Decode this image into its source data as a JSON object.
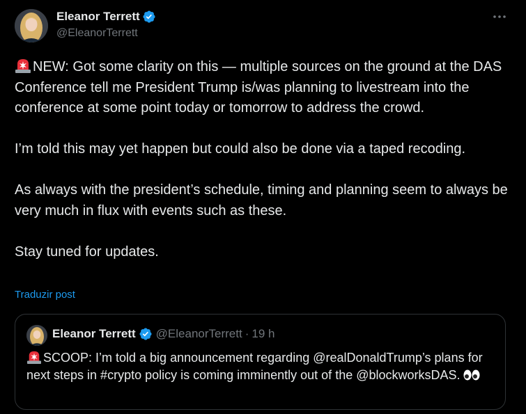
{
  "post": {
    "author": {
      "display_name": "Eleanor Terrett",
      "handle": "@EleanorTerrett",
      "avatar_icon": "profile-photo",
      "verified_icon": "verified-badge-icon"
    },
    "more_icon": "more-horizontal-icon",
    "paragraphs": [
      "NEW: Got some clarity on this — multiple sources on the ground at the DAS Conference tell me President Trump is/was planning to livestream into the conference at some point today or tomorrow to address the crowd.",
      "I’m told this may yet happen but could also be done via a taped recoding.",
      "As always with the president’s schedule, timing and planning seem to always be very much in flux with events such as these.",
      "Stay tuned for updates."
    ],
    "translate_label": "Traduzir post",
    "quoted": {
      "display_name": "Eleanor Terrett",
      "handle": "@EleanorTerrett",
      "separator": "·",
      "time": "19 h",
      "text": "SCOOP: I’m told a big announcement regarding @realDonaldTrump’s plans for next steps in #crypto policy is coming imminently out of the @blockworksDAS."
    }
  },
  "colors": {
    "background": "#000000",
    "text": "#e7e9ea",
    "secondary": "#71767b",
    "link": "#1d9bf0",
    "border": "#2f3336",
    "verified": "#1d9bf0"
  }
}
